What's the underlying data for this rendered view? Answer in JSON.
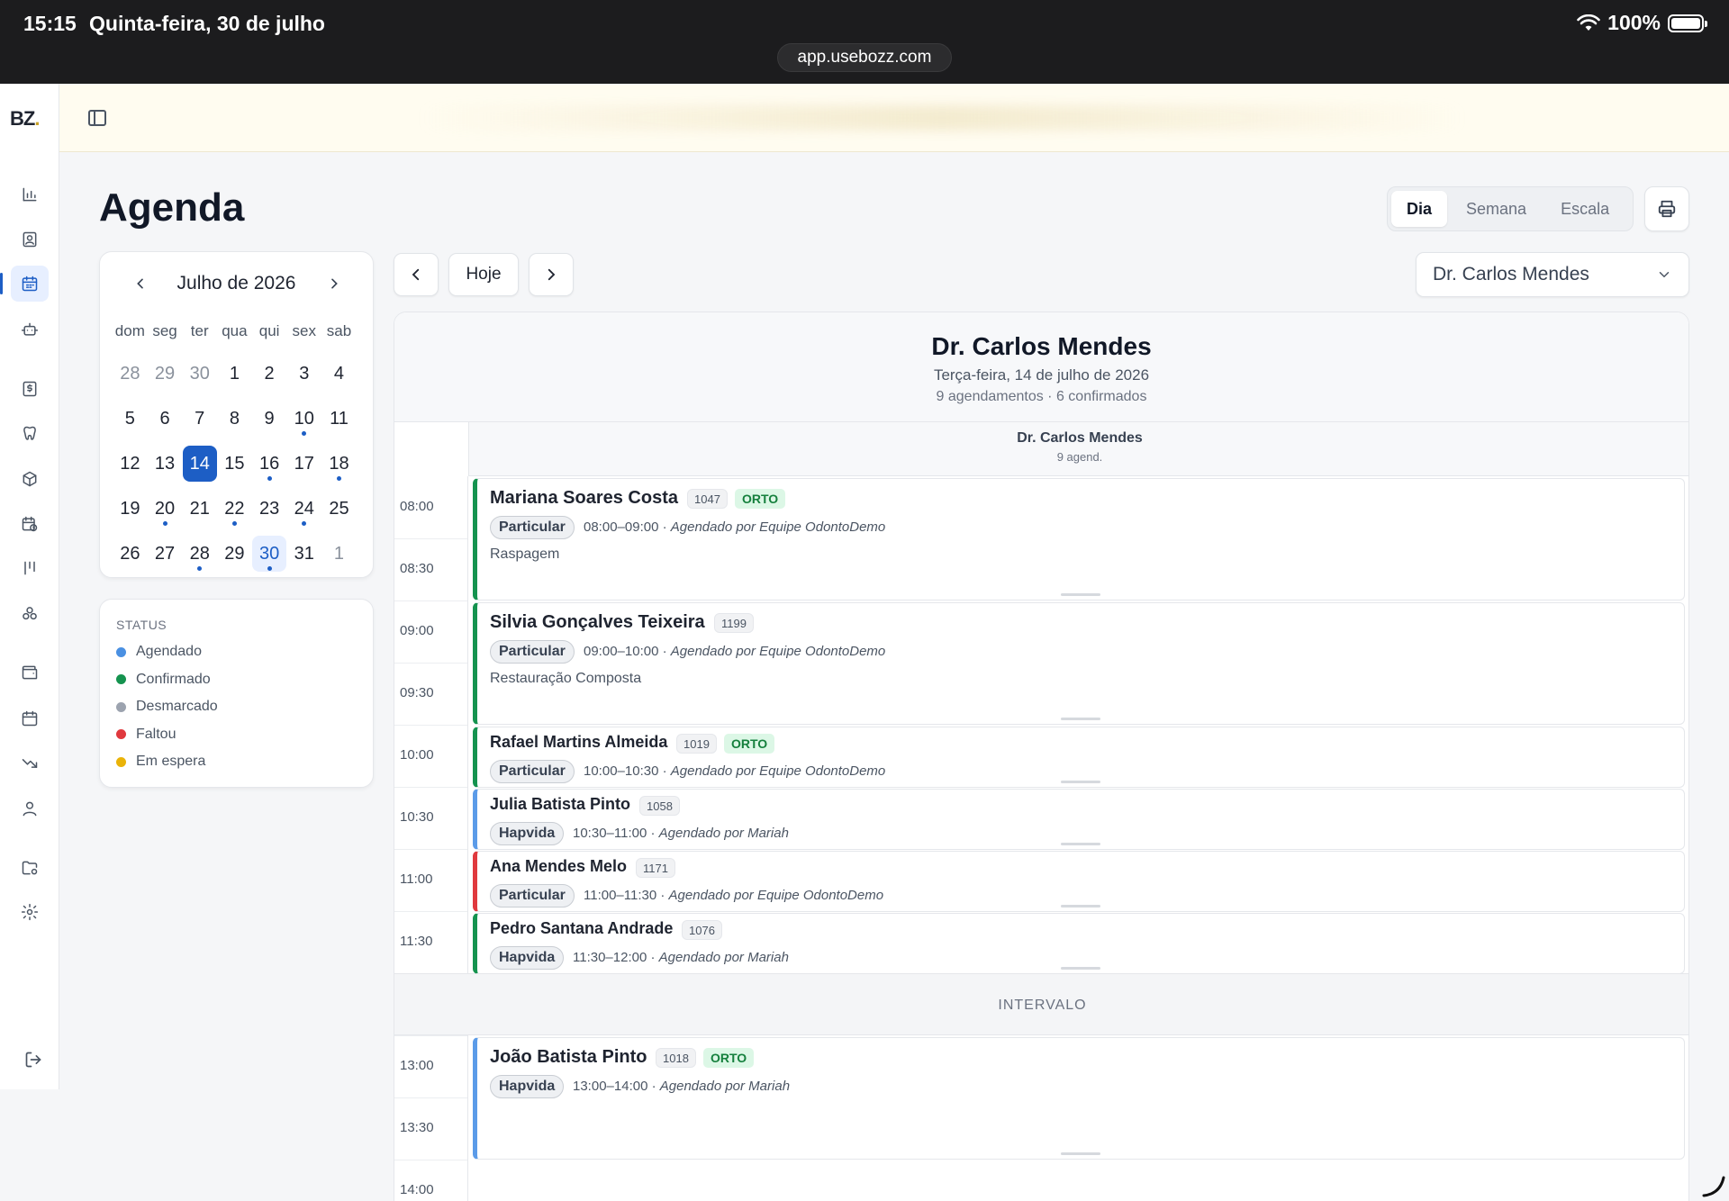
{
  "statusbar": {
    "time": "15:15",
    "date": "Quinta-feira, 30 de julho",
    "battery": "100%",
    "url": "app.usebozz.com"
  },
  "app": {
    "logo": "BZ",
    "logo_dot": "."
  },
  "sidebar": {
    "icons": [
      "dashboard-chart-icon",
      "patients-icon",
      "calendar-icon",
      "robot-icon",
      "finance-icon",
      "tooth-icon",
      "package-icon",
      "schedule-clock-icon",
      "kanban-icon",
      "clinics-icon",
      "wallet-icon",
      "calendar-alt-icon",
      "trend-down-icon",
      "user-icon",
      "folder-settings-icon",
      "settings-icon"
    ],
    "active": "calendar-icon",
    "logout": "logout-icon"
  },
  "page": {
    "title": "Agenda"
  },
  "views": {
    "dia": "Dia",
    "semana": "Semana",
    "escala": "Escala",
    "active": "Dia"
  },
  "toolbar": {
    "hoje": "Hoje",
    "doctor_select": "Dr. Carlos Mendes"
  },
  "minical": {
    "month": "Julho de 2026",
    "dow": [
      "dom",
      "seg",
      "ter",
      "qua",
      "qui",
      "sex",
      "sab"
    ],
    "weeks": [
      [
        {
          "d": "28",
          "m": true
        },
        {
          "d": "29",
          "m": true
        },
        {
          "d": "30",
          "m": true
        },
        {
          "d": "1"
        },
        {
          "d": "2"
        },
        {
          "d": "3"
        },
        {
          "d": "4"
        }
      ],
      [
        {
          "d": "5"
        },
        {
          "d": "6"
        },
        {
          "d": "7"
        },
        {
          "d": "8"
        },
        {
          "d": "9"
        },
        {
          "d": "10",
          "dot": true
        },
        {
          "d": "11"
        }
      ],
      [
        {
          "d": "12"
        },
        {
          "d": "13"
        },
        {
          "d": "14",
          "sel": true
        },
        {
          "d": "15"
        },
        {
          "d": "16",
          "dot": true
        },
        {
          "d": "17"
        },
        {
          "d": "18",
          "dot": true
        }
      ],
      [
        {
          "d": "19"
        },
        {
          "d": "20",
          "dot": true
        },
        {
          "d": "21"
        },
        {
          "d": "22",
          "dot": true
        },
        {
          "d": "23"
        },
        {
          "d": "24",
          "dot": true
        },
        {
          "d": "25"
        }
      ],
      [
        {
          "d": "26"
        },
        {
          "d": "27"
        },
        {
          "d": "28",
          "dot": true
        },
        {
          "d": "29"
        },
        {
          "d": "30",
          "today": true,
          "dot": true
        },
        {
          "d": "31"
        },
        {
          "d": "1",
          "m": true
        }
      ]
    ]
  },
  "status": {
    "title": "STATUS",
    "items": [
      {
        "label": "Agendado",
        "color": "#4a90e2"
      },
      {
        "label": "Confirmado",
        "color": "#15934f"
      },
      {
        "label": "Desmarcado",
        "color": "#9ca3af"
      },
      {
        "label": "Faltou",
        "color": "#e0393e"
      },
      {
        "label": "Em espera",
        "color": "#eab308"
      }
    ]
  },
  "schedule": {
    "doctor": "Dr. Carlos Mendes",
    "date": "Terça-feira, 14 de julho de 2026",
    "summary": "9 agendamentos · 6 confirmados",
    "column": {
      "name": "Dr. Carlos Mendes",
      "count": "9 agend."
    },
    "times": [
      "08:00",
      "08:30",
      "09:00",
      "09:30",
      "10:00",
      "10:30",
      "11:00",
      "11:30",
      "13:00",
      "13:30",
      "14:00"
    ],
    "interval_label": "INTERVALO",
    "appointments": [
      {
        "name": "Mariana Soares Costa",
        "code": "1047",
        "tag": "ORTO",
        "plan": "Particular",
        "time": "08:00–09:00",
        "by": "Agendado por Equipe OdontoDemo",
        "proc": "Raspagem",
        "status": "confirmado"
      },
      {
        "name": "Silvia Gonçalves Teixeira",
        "code": "1199",
        "tag": "",
        "plan": "Particular",
        "time": "09:00–10:00",
        "by": "Agendado por Equipe OdontoDemo",
        "proc": "Restauração Composta",
        "status": "confirmado"
      },
      {
        "name": "Rafael Martins Almeida",
        "code": "1019",
        "tag": "ORTO",
        "plan": "Particular",
        "time": "10:00–10:30",
        "by": "Agendado por Equipe OdontoDemo",
        "proc": "",
        "status": "confirmado"
      },
      {
        "name": "Julia Batista Pinto",
        "code": "1058",
        "tag": "",
        "plan": "Hapvida",
        "time": "10:30–11:00",
        "by": "Agendado por Mariah",
        "proc": "",
        "status": "agendado"
      },
      {
        "name": "Ana Mendes Melo",
        "code": "1171",
        "tag": "",
        "plan": "Particular",
        "time": "11:00–11:30",
        "by": "Agendado por Equipe OdontoDemo",
        "proc": "",
        "status": "faltou"
      },
      {
        "name": "Pedro Santana Andrade",
        "code": "1076",
        "tag": "",
        "plan": "Hapvida",
        "time": "11:30–12:00",
        "by": "Agendado por Mariah",
        "proc": "",
        "status": "confirmado"
      },
      {
        "name": "João Batista Pinto",
        "code": "1018",
        "tag": "ORTO",
        "plan": "Hapvida",
        "time": "13:00–14:00",
        "by": "Agendado por Mariah",
        "proc": "",
        "status": "agendado"
      }
    ]
  }
}
